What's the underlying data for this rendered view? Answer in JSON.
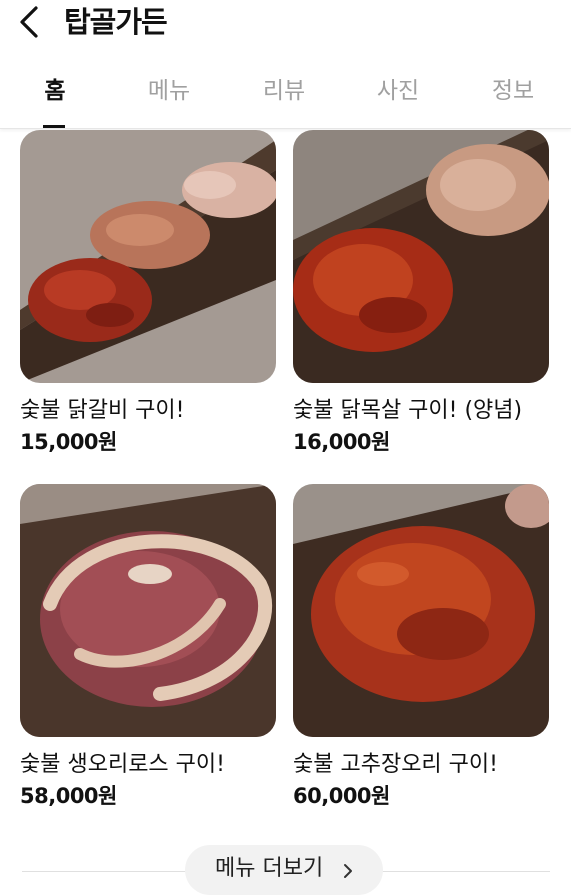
{
  "header": {
    "title": "탑골가든"
  },
  "tabs": [
    {
      "label": "홈",
      "active": true
    },
    {
      "label": "메뉴",
      "active": false
    },
    {
      "label": "리뷰",
      "active": false
    },
    {
      "label": "사진",
      "active": false
    },
    {
      "label": "정보",
      "active": false
    }
  ],
  "menu_items": [
    {
      "name": "숯불 닭갈비 구이!",
      "price": "15,000원"
    },
    {
      "name": "숯불 닭목살 구이! (양념)",
      "price": "16,000원"
    },
    {
      "name": "숯불 생오리로스 구이!",
      "price": "58,000원"
    },
    {
      "name": "숯불 고추장오리 구이!",
      "price": "60,000원"
    }
  ],
  "more_button": {
    "label": "메뉴 더보기"
  },
  "icons": {
    "back": "chevron-left-icon",
    "more": "chevron-right-icon"
  },
  "colors": {
    "text": "#111111",
    "inactive_tab": "#a0a0a0",
    "button_bg": "#f2f2f2"
  }
}
